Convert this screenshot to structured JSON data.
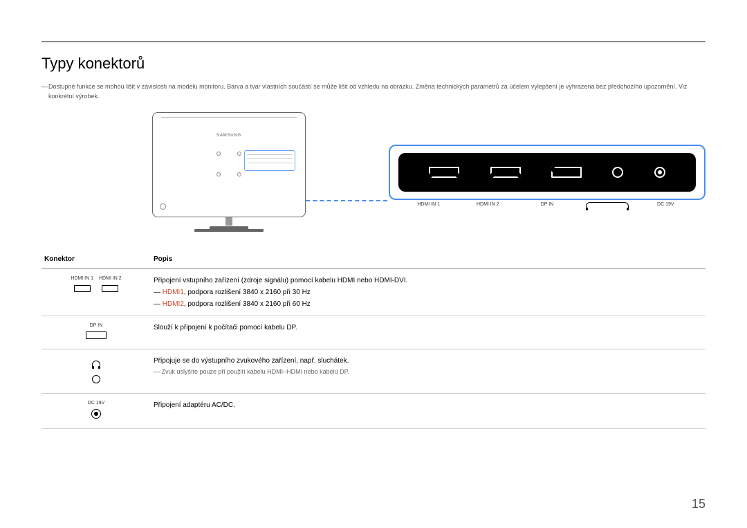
{
  "title": "Typy konektorů",
  "top_note": "Dostupné funkce se mohou lišit v závislosti na modelu monitoru. Barva a tvar vlastních součástí se může lišit od vzhledu na obrázku. Změna technických parametrů za účelem vylepšení je vyhrazena bez předchozího upozornění. Viz konkrétní výrobek.",
  "monitor_logo": "SAMSUNG",
  "zoom_labels": {
    "hdmi1": "HDMI IN 1",
    "hdmi2": "HDMI IN 2",
    "dp": "DP IN",
    "hp": "",
    "dc": "DC 19V"
  },
  "hp_icon_name": "headphone-icon",
  "table": {
    "h1": "Konektor",
    "h2": "Popis",
    "row1": {
      "labels": {
        "l1": "HDMI IN 1",
        "l2": "HDMI IN 2"
      },
      "line1": "Připojení vstupního zařízení (zdroje signálu) pomocí kabelu HDMI nebo HDMI-DVI.",
      "hdmi1": "HDMI1",
      "hdmi1_rest": ", podpora rozlišení 3840 x 2160 při 30 Hz",
      "hdmi2": "HDMI2",
      "hdmi2_rest": ", podpora rozlišení 3840 x 2160 při 60 Hz"
    },
    "row2": {
      "label": "DP IN",
      "desc": "Slouží k připojení k počítači pomocí kabelu DP."
    },
    "row3": {
      "desc": "Připojuje se do výstupního zvukového zařízení, např. sluchátek.",
      "sub": "Zvuk uslyšíte pouze při použití kabelu HDMI–HDMI nebo kabelu DP."
    },
    "row4": {
      "label": "DC 19V",
      "desc": "Připojení adaptéru AC/DC."
    }
  },
  "page_number": "15"
}
